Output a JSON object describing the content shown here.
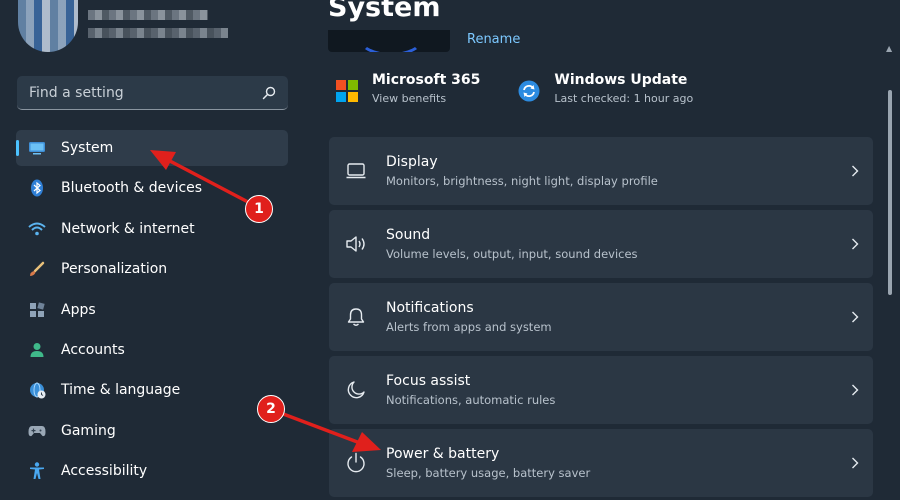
{
  "sidebar": {
    "search_placeholder": "Find a setting",
    "items": [
      {
        "label": "System",
        "icon": "monitor-icon"
      },
      {
        "label": "Bluetooth & devices",
        "icon": "bluetooth-icon"
      },
      {
        "label": "Network & internet",
        "icon": "wifi-icon"
      },
      {
        "label": "Personalization",
        "icon": "brush-icon"
      },
      {
        "label": "Apps",
        "icon": "apps-icon"
      },
      {
        "label": "Accounts",
        "icon": "person-icon"
      },
      {
        "label": "Time & language",
        "icon": "globe-clock-icon"
      },
      {
        "label": "Gaming",
        "icon": "gamepad-icon"
      },
      {
        "label": "Accessibility",
        "icon": "accessibility-icon"
      }
    ]
  },
  "main": {
    "title": "System",
    "rename_label": "Rename",
    "quick_links": [
      {
        "title": "Microsoft 365",
        "subtitle": "View benefits",
        "icon": "microsoft-logo-icon"
      },
      {
        "title": "Windows Update",
        "subtitle": "Last checked: 1 hour ago",
        "icon": "windows-update-icon"
      }
    ],
    "cards": [
      {
        "title": "Display",
        "subtitle": "Monitors, brightness, night light, display profile",
        "icon": "display-icon"
      },
      {
        "title": "Sound",
        "subtitle": "Volume levels, output, input, sound devices",
        "icon": "speaker-icon"
      },
      {
        "title": "Notifications",
        "subtitle": "Alerts from apps and system",
        "icon": "bell-icon"
      },
      {
        "title": "Focus assist",
        "subtitle": "Notifications, automatic rules",
        "icon": "moon-icon"
      },
      {
        "title": "Power & battery",
        "subtitle": "Sleep, battery usage, battery saver",
        "icon": "power-icon"
      }
    ]
  },
  "annotations": {
    "step1": "1",
    "step2": "2"
  },
  "colors": {
    "background": "#1f2a36",
    "card": "#2b3744",
    "accent": "#4cc2ff",
    "annotation": "#e0201c"
  }
}
